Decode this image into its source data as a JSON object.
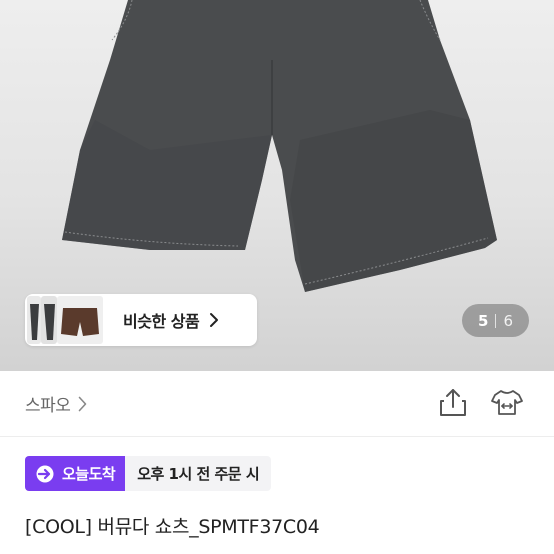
{
  "gallery": {
    "similar_label": "비슷한 상품",
    "current_page": "5",
    "total_pages": "6",
    "overlay_color": "#6e6e6e"
  },
  "brand": {
    "name": "스파오"
  },
  "delivery": {
    "badge_label": "오늘도착",
    "badge_color": "#7a3df0",
    "condition": "오후 1시 전 주문 시"
  },
  "product": {
    "title": "[COOL] 버뮤다 쇼츠_SPMTF37C04"
  },
  "icons": {
    "similar_arrow": "chevron-right-icon",
    "brand_arrow": "chevron-right-icon",
    "share": "share-icon",
    "size": "tshirt-size-icon",
    "delivery": "delivery-arrow-icon"
  }
}
